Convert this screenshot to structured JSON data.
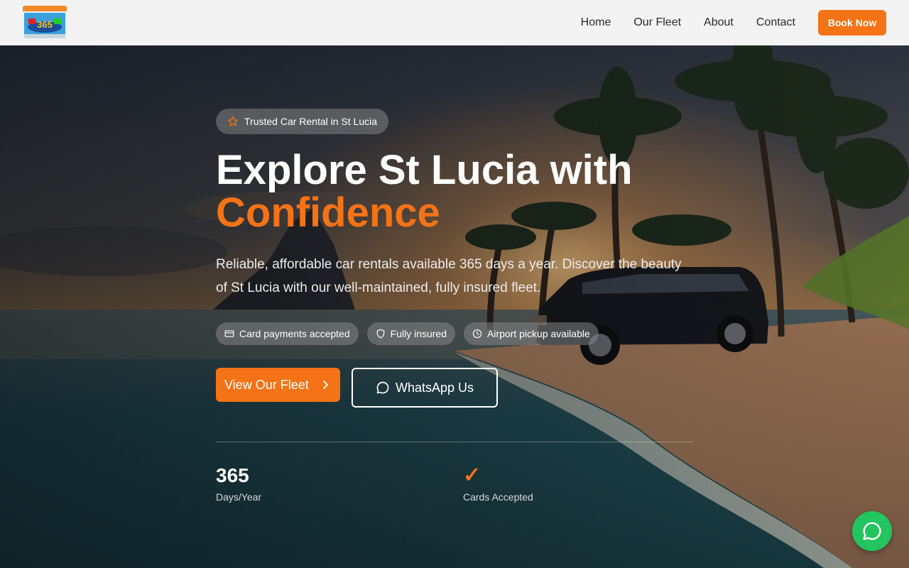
{
  "header": {
    "logo_alt": "365 car rental logo",
    "nav": [
      {
        "label": "Home"
      },
      {
        "label": "Our Fleet"
      },
      {
        "label": "About"
      },
      {
        "label": "Contact"
      }
    ],
    "book_label": "Book Now"
  },
  "hero": {
    "badge": "Trusted Car Rental in St Lucia",
    "title_line1": "Explore St Lucia with",
    "title_line2": "Confidence",
    "description": "Reliable, affordable car rentals available 365 days a year. Discover the beauty of St Lucia with our well-maintained, fully insured fleet.",
    "pills": [
      {
        "icon": "credit-card-icon",
        "label": "Card payments accepted"
      },
      {
        "icon": "shield-icon",
        "label": "Fully insured"
      },
      {
        "icon": "clock-icon",
        "label": "Airport pickup available"
      }
    ],
    "fleet_button": "View Our Fleet",
    "whatsapp_button": "WhatsApp Us",
    "stats": [
      {
        "value": "365",
        "label": "Days/Year"
      },
      {
        "value": "✓",
        "label": "Cards Accepted"
      }
    ]
  },
  "colors": {
    "accent": "#f37316",
    "whatsapp": "#22c55e",
    "header_bg": "#f3f3f4"
  }
}
